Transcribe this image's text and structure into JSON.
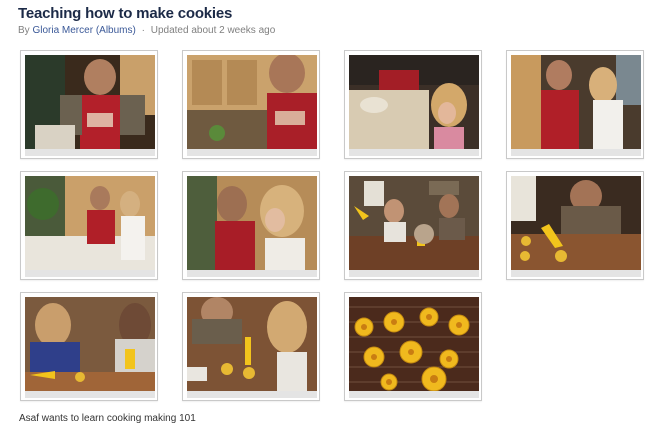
{
  "album": {
    "title": "Teaching how to make cookies",
    "by_label": "By",
    "author": "Gloria Mercer",
    "albums_link": "(Albums)",
    "separator": "·",
    "updated": "Updated about 2 weeks ago"
  },
  "photos": [
    {
      "id": 1,
      "description": "Man in red Food & Wine apron cooking at counter"
    },
    {
      "id": 2,
      "description": "Man in apron in kitchen with wooden cabinets"
    },
    {
      "id": 3,
      "description": "Girl with curly hair watching dough being prepared"
    },
    {
      "id": 4,
      "description": "Man and girl standing together in kitchen"
    },
    {
      "id": 5,
      "description": "Kitchen with man and woman at counter"
    },
    {
      "id": 6,
      "description": "Man and woman looking down at counter"
    },
    {
      "id": 7,
      "description": "Family decorating cookies at dining table"
    },
    {
      "id": 8,
      "description": "Man piping yellow icing on cookies"
    },
    {
      "id": 9,
      "description": "Two girls piping icing onto cookies"
    },
    {
      "id": 10,
      "description": "Man and girl decorating cookies at table"
    },
    {
      "id": 11,
      "description": "Yellow flower cookies on cooling rack"
    }
  ],
  "caption": "Asaf wants to learn cooking making 101"
}
